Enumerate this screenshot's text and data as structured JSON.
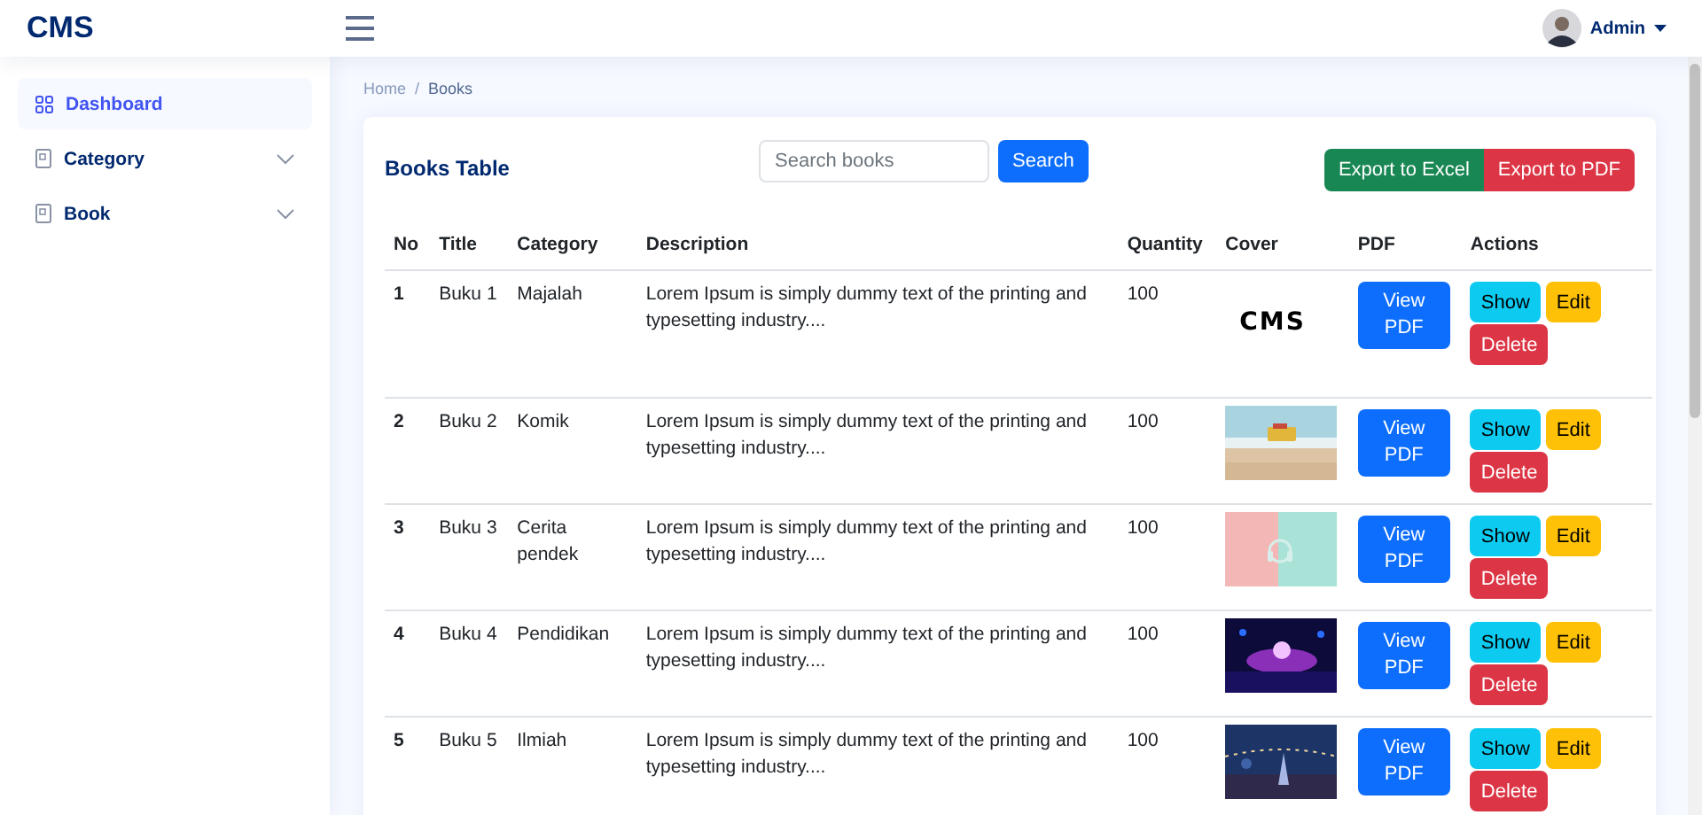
{
  "brand": "CMS",
  "user": {
    "name": "Admin"
  },
  "sidebar": {
    "items": [
      {
        "label": "Dashboard",
        "kind": "grid",
        "selected": true,
        "expandable": false
      },
      {
        "label": "Category",
        "kind": "doc",
        "selected": false,
        "expandable": true
      },
      {
        "label": "Book",
        "kind": "doc",
        "selected": false,
        "expandable": true
      }
    ]
  },
  "breadcrumb": {
    "items": [
      "Home",
      "Books"
    ],
    "separator": "/"
  },
  "card": {
    "title": "Books Table",
    "search": {
      "placeholder": "Search books",
      "button": "Search"
    },
    "export_buttons": [
      {
        "label": "Export to Excel",
        "kind": "excel"
      },
      {
        "label": "Export to PDF",
        "kind": "pdf"
      }
    ]
  },
  "table": {
    "columns": [
      "No",
      "Title",
      "Category",
      "Description",
      "Quantity",
      "Cover",
      "PDF",
      "Actions"
    ],
    "rows": [
      {
        "no": "1",
        "title": "Buku 1",
        "category": "Majalah",
        "description": "Lorem Ipsum is simply dummy text of the printing and typesetting industry....",
        "quantity": "100",
        "cover": {
          "kind": "logo",
          "text": "CMS"
        },
        "pdf": "View PDF",
        "actions": [
          "Show",
          "Edit",
          "Delete"
        ]
      },
      {
        "no": "2",
        "title": "Buku 2",
        "category": "Komik",
        "description": "Lorem Ipsum is simply dummy text of the printing and typesetting industry....",
        "quantity": "100",
        "pdf": "View PDF",
        "actions": [
          "Show",
          "Edit",
          "Delete"
        ]
      },
      {
        "no": "3",
        "title": "Buku 3",
        "category": "Cerita pendek",
        "description": "Lorem Ipsum is simply dummy text of the printing and typesetting industry....",
        "quantity": "100",
        "pdf": "View PDF",
        "actions": [
          "Show",
          "Edit",
          "Delete"
        ]
      },
      {
        "no": "4",
        "title": "Buku 4",
        "category": "Pendidikan",
        "description": "Lorem Ipsum is simply dummy text of the printing and typesetting industry....",
        "quantity": "100",
        "pdf": "View PDF",
        "actions": [
          "Show",
          "Edit",
          "Delete"
        ]
      },
      {
        "no": "5",
        "title": "Buku 5",
        "category": "Ilmiah",
        "description": "Lorem Ipsum is simply dummy text of the printing and typesetting industry....",
        "quantity": "100",
        "pdf": "View PDF",
        "actions": [
          "Show",
          "Edit",
          "Delete"
        ]
      }
    ]
  }
}
